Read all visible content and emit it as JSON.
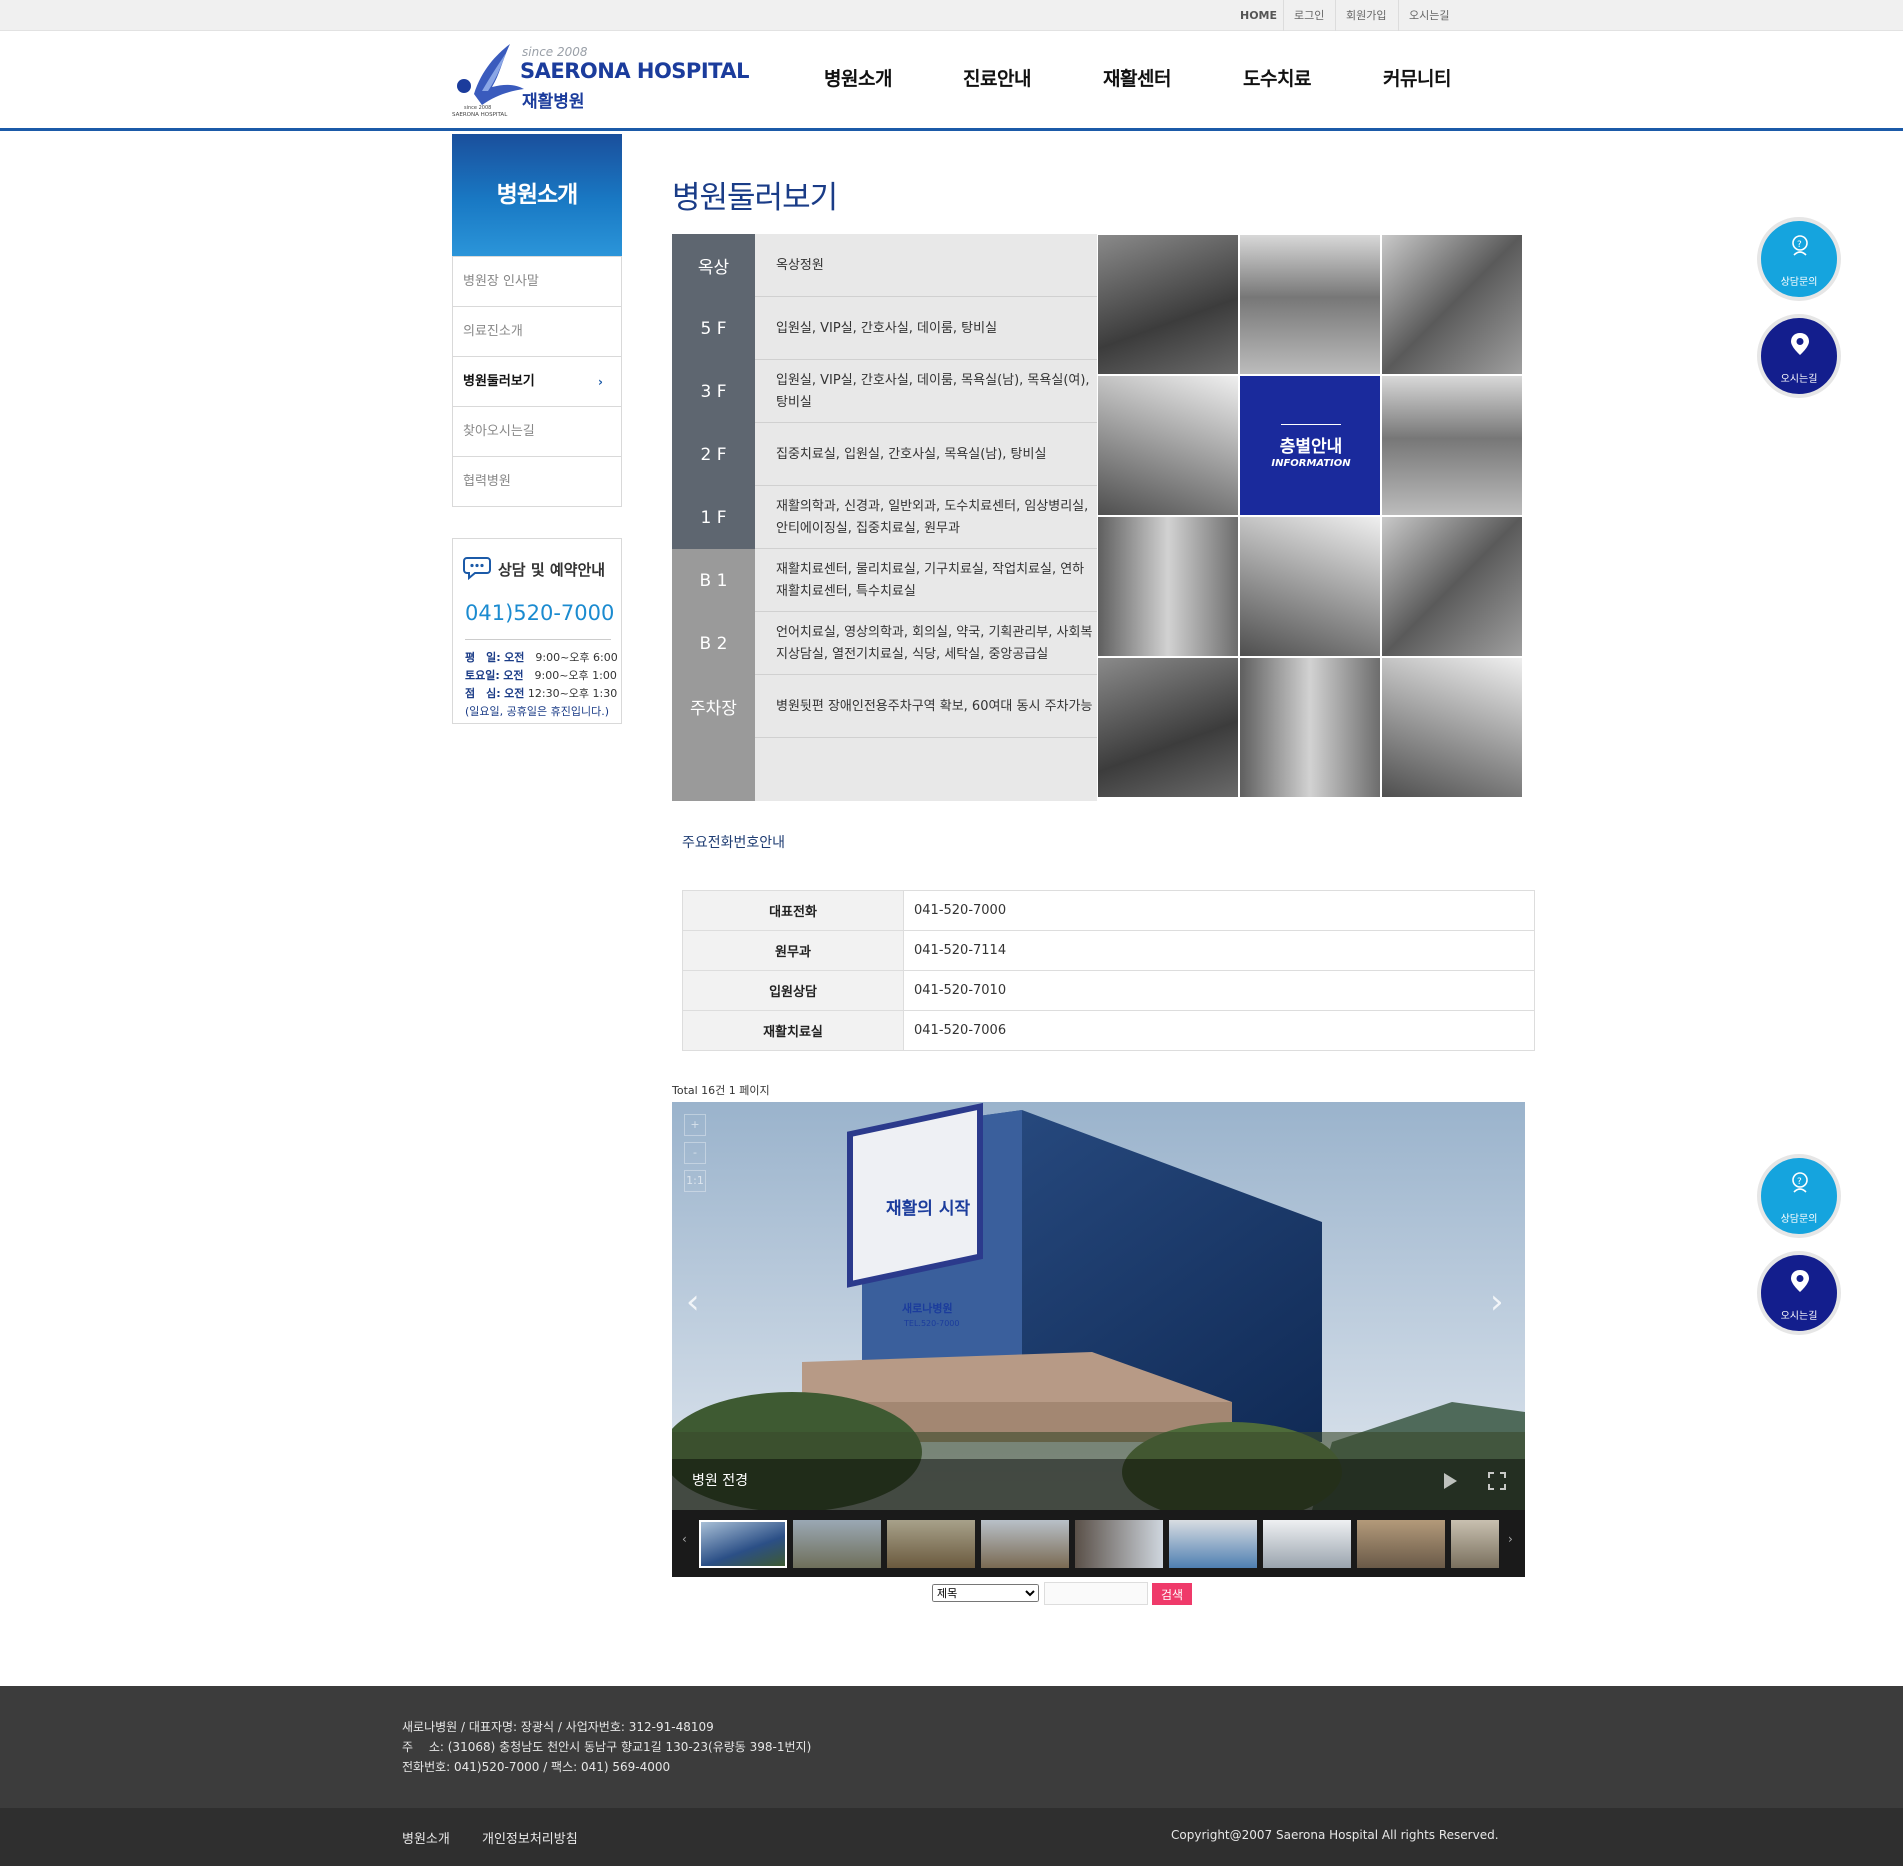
{
  "topbar": {
    "links": [
      "HOME",
      "로그인",
      "회원가입",
      "오시는길"
    ]
  },
  "logo": {
    "since": "since 2008",
    "name": "SAERONA HOSPITAL",
    "sub": "재활병원",
    "mark_text_1": "since 2008",
    "mark_text_2": "SAERONA HOSPITAL"
  },
  "gnb": [
    "병원소개",
    "진료안내",
    "재활센터",
    "도수치료",
    "커뮤니티"
  ],
  "lnb": {
    "title": "병원소개",
    "items": [
      {
        "label": "병원장 인사말",
        "active": false
      },
      {
        "label": "의료진소개",
        "active": false
      },
      {
        "label": "병원둘러보기",
        "active": true
      },
      {
        "label": "찾아오시는길",
        "active": false
      },
      {
        "label": "협력병원",
        "active": false
      }
    ],
    "arrow": "›"
  },
  "consult": {
    "title": "상담 및 예약안내",
    "phone": "041)520-7000",
    "hours": [
      {
        "day": "평　일:",
        "slot": "오전",
        "time": "9:00~오후 6:00"
      },
      {
        "day": "토요일:",
        "slot": "오전",
        "time": "9:00~오후 1:00"
      },
      {
        "day": "점　심:",
        "slot": "오전",
        "time": "12:30~오후 1:30"
      }
    ],
    "note": "(일요일, 공휴일은 휴진입니다.)"
  },
  "page_title": "병원둘러보기",
  "floors": [
    {
      "label": "옥상",
      "desc": "옥상정원"
    },
    {
      "label": "5 F",
      "desc": "입원실, VIP실, 간호사실, 데이룸, 탕비실"
    },
    {
      "label": "3 F",
      "desc": "입원실, VIP실, 간호사실, 데이룸, 목욕실(남), 목욕실(여), 탕비실"
    },
    {
      "label": "2 F",
      "desc": "집중치료실, 입원실, 간호사실, 목욕실(남), 탕비실"
    },
    {
      "label": "1 F",
      "desc": "재활의학과, 신경과, 일반외과, 도수치료센터, 임상병리실, 안티에이징실, 집중치료실, 원무과"
    },
    {
      "label": "B 1",
      "desc": "재활치료센터, 물리치료실, 기구치료실, 작업치료실, 연하재활치료센터, 특수치료실"
    },
    {
      "label": "B 2",
      "desc": "언어치료실, 영상의학과, 회의실, 약국, 기획관리부, 사회복지상담실, 열전기치료실, 식당, 세탁실, 중앙공급실"
    },
    {
      "label": "주차장",
      "desc": "병원뒷편 장애인전용주차구역 확보, 60여대 동시 주차가능"
    },
    {
      "label": "",
      "desc": ""
    }
  ],
  "grid": {
    "info_title": "층별안내",
    "info_sub": "INFORMATION"
  },
  "phones": {
    "title": "주요전화번호안내",
    "rows": [
      {
        "label": "대표전화",
        "value": "041-520-7000"
      },
      {
        "label": "원무과",
        "value": "041-520-7114"
      },
      {
        "label": "입원상담",
        "value": "041-520-7010"
      },
      {
        "label": "재활치료실",
        "value": "041-520-7006"
      }
    ]
  },
  "total": "Total 16건 1 페이지",
  "gallery": {
    "caption": "병원 전경",
    "banner_title": "재활의 시작",
    "banner_name": "새로나병원",
    "banner_tel": "TEL.520-7000",
    "tools": [
      "+",
      "-",
      "1:1"
    ]
  },
  "search": {
    "select_value": "제목",
    "button": "검색"
  },
  "floating": [
    {
      "label": "상담문의"
    },
    {
      "label": "오시는길"
    },
    {
      "label": "상담문의"
    },
    {
      "label": "오시는길"
    }
  ],
  "footer": {
    "line1": "새로나병원 / 대표자명: 장광식 / 사업자번호: 312-91-48109",
    "line2": "주　 소: (31068) 충청남도 천안시 동남구 향교1길 130-23(유량동 398-1번지)",
    "line3": "전화번호: 041)520-7000 / 팩스: 041) 569-4000",
    "links": [
      "병원소개",
      "개인정보처리방침"
    ],
    "copyright": "Copyright@2007 Saerona Hospital All rights Reserved."
  },
  "colors": {
    "brand_blue": "#1b5aa8",
    "navy": "#1a2a9c",
    "floor_dark": "#5e6670",
    "floor_gray": "#9a9a9a",
    "search_button": "#ef3a6a",
    "consult_float": "#15a4de",
    "map_float": "#131e8d"
  }
}
